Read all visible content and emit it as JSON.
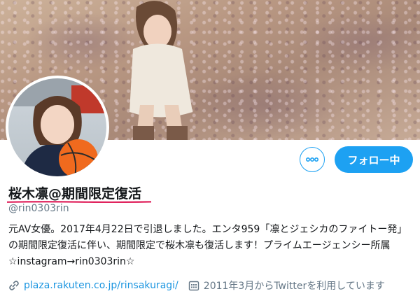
{
  "profile": {
    "display_name": "桜木凛@期間限定復活",
    "handle": "@rin0303rin",
    "bio": "元AV女優。2017年4月22日で引退しました。エンタ959「凛とジェシカのファイトー発」の期間限定復活に伴い、期間限定で桜木凛も復活します！プライムエージェンシー所属 ☆instagram→rin0303rin☆",
    "website": "plaza.rakuten.co.jp/rinsakuragi/",
    "joined": "2011年3月からTwitterを利用しています"
  },
  "actions": {
    "more_icon": "more-dots-icon",
    "follow_label": "フォロー中"
  },
  "colors": {
    "accent": "#1da1f2",
    "link": "#1b95e0",
    "secondary_text": "#657786",
    "underline": "#e0245e"
  }
}
